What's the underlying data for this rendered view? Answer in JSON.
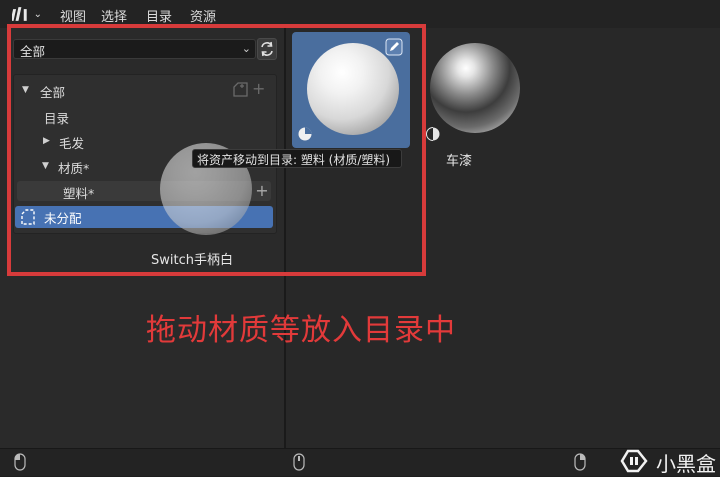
{
  "header": {
    "menus": [
      "视图",
      "选择",
      "目录",
      "资源"
    ]
  },
  "sidebar": {
    "library_dropdown": "全部",
    "tree": {
      "root": "全部",
      "catalog": "目录",
      "hair": "毛发",
      "material": "材质*",
      "plastic": "塑料*",
      "unassigned": "未分配"
    }
  },
  "tooltip": "将资产移动到目录: 塑料 (材质/塑料)",
  "assets": {
    "drag_name": "Switch手柄白",
    "car_paint": "车漆"
  },
  "annotation": "拖动材质等放入目录中",
  "watermark": "小黑盒"
}
